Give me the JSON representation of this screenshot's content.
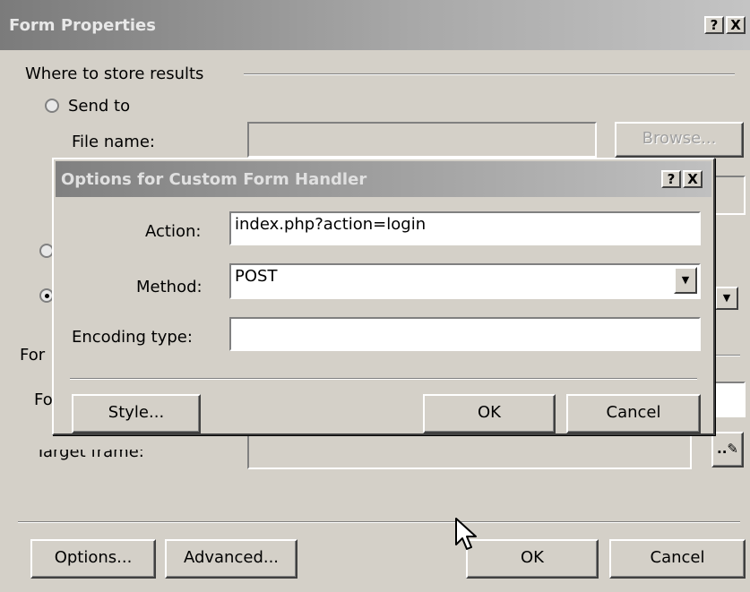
{
  "outer": {
    "title": "Form Properties",
    "help_btn": "?",
    "close_btn": "X",
    "group_where": "Where to store results",
    "send_to_label": "Send to",
    "file_name_label": "File name:",
    "browse_label": "Browse...",
    "form_label_partial": "For",
    "form_name_partial": "Fo",
    "target_frame_label": "Target frame:",
    "options_label": "Options...",
    "advanced_label": "Advanced...",
    "ok_label": "OK",
    "cancel_label": "Cancel"
  },
  "dialog": {
    "title": "Options for Custom Form Handler",
    "help_btn": "?",
    "close_btn": "X",
    "action_label": "Action:",
    "action_value": "index.php?action=login",
    "method_label": "Method:",
    "method_value": "POST",
    "encoding_label": "Encoding type:",
    "encoding_value": "",
    "style_label": "Style...",
    "ok_label": "OK",
    "cancel_label": "Cancel"
  },
  "icons": {
    "dropdown": "▼",
    "pencil": "..✎"
  }
}
